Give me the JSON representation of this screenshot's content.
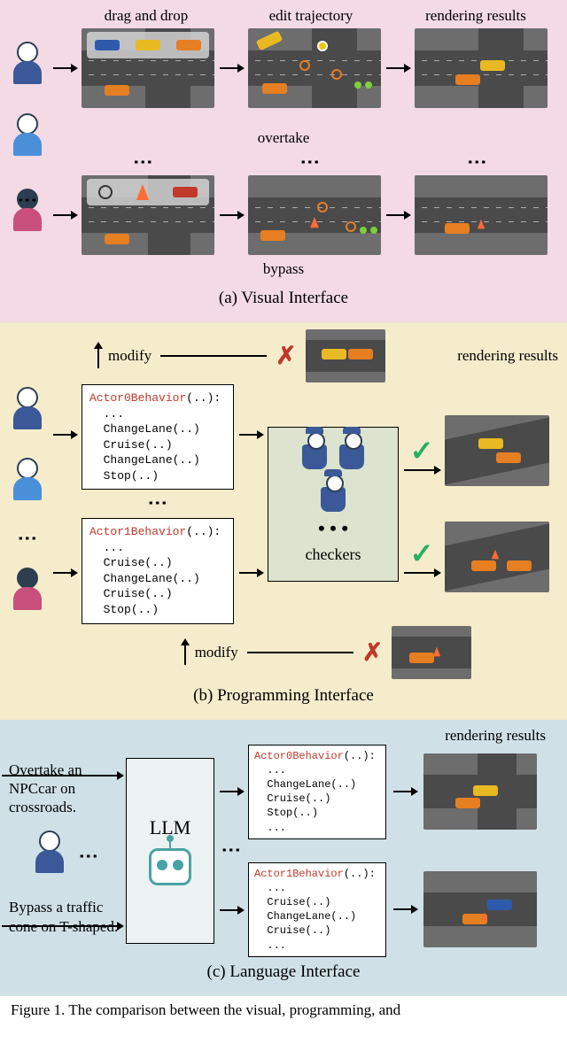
{
  "panelA": {
    "headers": [
      "drag and drop",
      "edit trajectory",
      "rendering results"
    ],
    "midLabel1": "overtake",
    "midLabel2": "bypass",
    "caption": "(a) Visual Interface"
  },
  "panelB": {
    "modify": "modify",
    "rendHeader": "rendering results",
    "code0": {
      "fn": "Actor0Behavior",
      "lines": [
        "...",
        "ChangeLane(..)",
        "Cruise(..)",
        "ChangeLane(..)",
        "Stop(..)"
      ]
    },
    "code1": {
      "fn": "Actor1Behavior",
      "lines": [
        "...",
        "Cruise(..)",
        "ChangeLane(..)",
        "Cruise(..)",
        "Stop(..)"
      ]
    },
    "checkers": "checkers",
    "caption": "(b) Programming Interface"
  },
  "panelC": {
    "input1": "Overtake an NPCcar on crossroads.",
    "input2": "Bypass a traffic cone on T-shaped.",
    "llm": "LLM",
    "rendHeader": "rendering results",
    "code0": {
      "fn": "Actor0Behavior",
      "lines": [
        "...",
        "ChangeLane(..)",
        "Cruise(..)",
        "Stop(..)",
        "..."
      ]
    },
    "code1": {
      "fn": "Actor1Behavior",
      "lines": [
        "...",
        "Cruise(..)",
        "ChangeLane(..)",
        "Cruise(..)",
        "..."
      ]
    },
    "caption": "(c) Language Interface"
  },
  "figureCaption": "Figure 1. The comparison between the visual, programming, and"
}
